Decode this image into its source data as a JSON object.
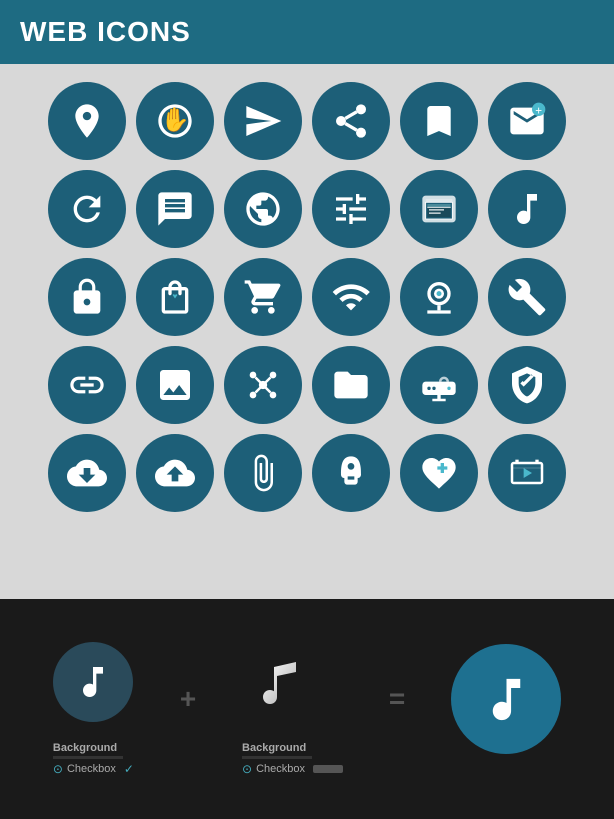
{
  "header": {
    "title": "WEB ICONS",
    "bg_color": "#1e6b82"
  },
  "icons": {
    "rows": [
      [
        {
          "name": "location-pin-icon",
          "symbol": "📍"
        },
        {
          "name": "stop-hand-icon",
          "symbol": "✋"
        },
        {
          "name": "paper-plane-icon",
          "symbol": "✈"
        },
        {
          "name": "network-icon",
          "symbol": "⬤"
        },
        {
          "name": "bookmark-icon",
          "symbol": "🔖"
        },
        {
          "name": "mail-icon",
          "symbol": "✉"
        }
      ],
      [
        {
          "name": "refresh-icon",
          "symbol": "↻"
        },
        {
          "name": "chat-icon",
          "symbol": "💬"
        },
        {
          "name": "globe-icon",
          "symbol": "🌐"
        },
        {
          "name": "sliders-icon",
          "symbol": "⚙"
        },
        {
          "name": "browser-icon",
          "symbol": "🖥"
        },
        {
          "name": "music-note-icon",
          "symbol": "♫"
        }
      ],
      [
        {
          "name": "lock-icon",
          "symbol": "🔒"
        },
        {
          "name": "shopping-bag-icon",
          "symbol": "🛍"
        },
        {
          "name": "shopping-cart-icon",
          "symbol": "🛒"
        },
        {
          "name": "wifi-icon",
          "symbol": "📶"
        },
        {
          "name": "webcam-icon",
          "symbol": "📷"
        },
        {
          "name": "wrench-icon",
          "symbol": "🔧"
        }
      ],
      [
        {
          "name": "link-icon",
          "symbol": "🔗"
        },
        {
          "name": "image-icon",
          "symbol": "🖼"
        },
        {
          "name": "network-hub-icon",
          "symbol": "⚙"
        },
        {
          "name": "folder-icon",
          "symbol": "📁"
        },
        {
          "name": "router-icon",
          "symbol": "📡"
        },
        {
          "name": "shield-icon",
          "symbol": "🛡"
        }
      ],
      [
        {
          "name": "cloud-download-icon",
          "symbol": "⬇"
        },
        {
          "name": "cloud-upload-icon",
          "symbol": "⬆"
        },
        {
          "name": "paperclip-icon",
          "symbol": "📎"
        },
        {
          "name": "rocket-icon",
          "symbol": "🚀"
        },
        {
          "name": "heart-plus-icon",
          "symbol": "❤"
        },
        {
          "name": "video-play-icon",
          "symbol": "▶"
        }
      ]
    ]
  },
  "bottom": {
    "plus_label": "+",
    "equals_label": "=",
    "left_item": {
      "background_label": "Background",
      "checkbox_label": "Checkbox"
    },
    "middle_item": {
      "background_label": "Background",
      "checkbox_label": "Checkbox"
    }
  }
}
